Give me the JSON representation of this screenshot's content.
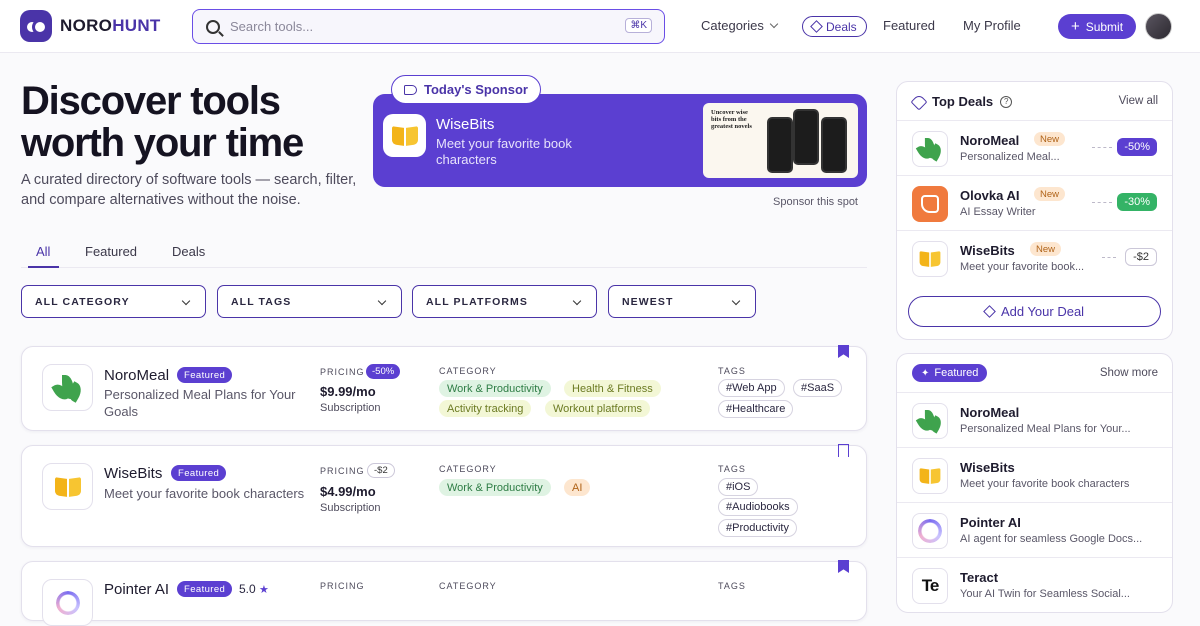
{
  "brand": {
    "name_a": "NORO",
    "name_b": "HUNT"
  },
  "search": {
    "placeholder": "Search tools...",
    "shortcut": "⌘K"
  },
  "nav": {
    "categories": "Categories",
    "deals": "Deals",
    "featured": "Featured",
    "profile": "My Profile",
    "submit": "Submit"
  },
  "hero": {
    "title": "Discover tools worth your time",
    "subtitle": "A curated directory of software tools — search, filter, and compare alternatives without the noise."
  },
  "sponsor": {
    "tag": "Today's Sponsor",
    "name": "WiseBits",
    "description": "Meet your favorite book characters",
    "shot_text": "Uncover wise bits from the greatest novels",
    "link": "Sponsor this spot"
  },
  "tabs": [
    "All",
    "Featured",
    "Deals"
  ],
  "filters": [
    "ALL CATEGORY",
    "ALL TAGS",
    "ALL PLATFORMS",
    "NEWEST"
  ],
  "labels": {
    "pricing": "PRICING",
    "category": "CATEGORY",
    "tags": "TAGS",
    "featured": "Featured"
  },
  "tools": [
    {
      "name": "NoroMeal",
      "description": "Personalized Meal Plans for Your Goals",
      "price_badge": "-50%",
      "price": "$9.99/mo",
      "price_type": "Subscription",
      "categories": [
        "Work & Productivity",
        "Health & Fitness",
        "Activity tracking",
        "Workout platforms"
      ],
      "tags": [
        "#Web App",
        "#SaaS",
        "#Healthcare"
      ]
    },
    {
      "name": "WiseBits",
      "description": "Meet your favorite book characters",
      "price_badge": "-$2",
      "price": "$4.99/mo",
      "price_type": "Subscription",
      "categories": [
        "Work & Productivity",
        "AI"
      ],
      "tags": [
        "#iOS",
        "#Audiobooks",
        "#Productivity"
      ]
    },
    {
      "name": "Pointer AI",
      "rating": "5.0"
    }
  ],
  "top_deals": {
    "title": "Top Deals",
    "link": "View all",
    "add_label": "Add Your Deal",
    "items": [
      {
        "name": "NoroMeal",
        "badge": "New",
        "description": "Personalized Meal...",
        "value": "-50%"
      },
      {
        "name": "Olovka AI",
        "badge": "New",
        "description": "AI Essay Writer",
        "value": "-30%"
      },
      {
        "name": "WiseBits",
        "badge": "New",
        "description": "Meet your favorite book...",
        "value": "-$2"
      }
    ]
  },
  "featured_panel": {
    "title": "Featured",
    "link": "Show more",
    "items": [
      {
        "name": "NoroMeal",
        "description": "Personalized Meal Plans for Your..."
      },
      {
        "name": "WiseBits",
        "description": "Meet your favorite book characters"
      },
      {
        "name": "Pointer AI",
        "description": "AI agent for seamless Google Docs..."
      },
      {
        "name": "Teract",
        "description": "Your AI Twin for Seamless Social..."
      }
    ]
  },
  "colors": {
    "accent": "#5b3fd1",
    "deal_green": "#34b366"
  }
}
